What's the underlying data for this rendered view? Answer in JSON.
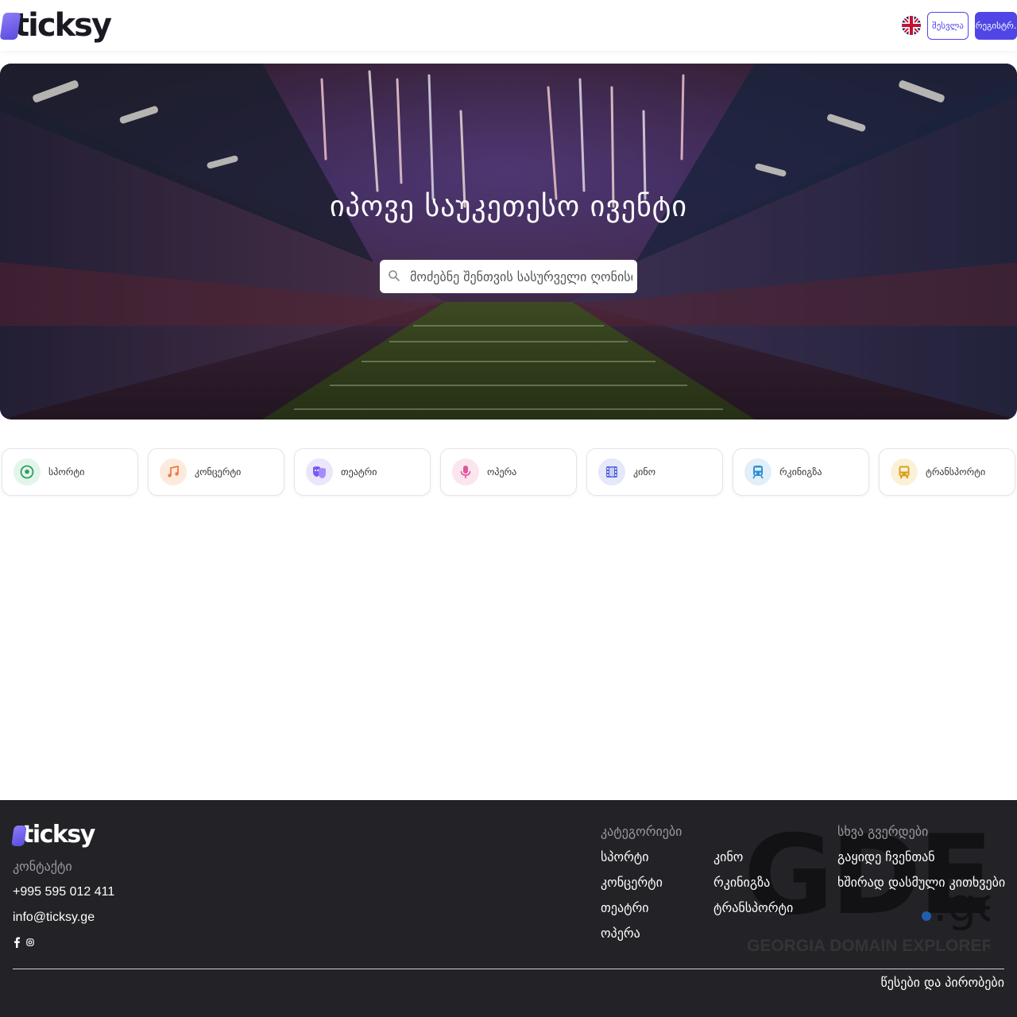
{
  "brand": {
    "name": "ticksy"
  },
  "header": {
    "login_label": "შესვლა",
    "register_label": "რეგისტრ."
  },
  "hero": {
    "title": "იპოვე საუკეთესო ივენტი",
    "search_placeholder": "მოძებნე შენთვის სასურველი ღონისძიება"
  },
  "categories": [
    {
      "label": "სპორტი",
      "icon": "soccer-ball-icon",
      "color": "#2f9e63",
      "bg": "#e3f5ea"
    },
    {
      "label": "კონცერტი",
      "icon": "music-note-icon",
      "color": "#ef7b3c",
      "bg": "#fdeadf"
    },
    {
      "label": "თეატრი",
      "icon": "theater-masks-icon",
      "color": "#7a5af0",
      "bg": "#ece6fd"
    },
    {
      "label": "ოპერა",
      "icon": "microphone-icon",
      "color": "#e0569b",
      "bg": "#fbe5ef"
    },
    {
      "label": "კინო",
      "icon": "film-icon",
      "color": "#5564d9",
      "bg": "#e5e8fb"
    },
    {
      "label": "რკინიგზა",
      "icon": "train-icon",
      "color": "#2f8fd0",
      "bg": "#e0effa"
    },
    {
      "label": "ტრანსპორტი",
      "icon": "bus-icon",
      "color": "#d9a21f",
      "bg": "#fbf1d8"
    }
  ],
  "footer": {
    "contact_heading": "კონტაქტი",
    "phone": "+995 595 012 411",
    "email": "info@ticksy.ge",
    "categories_heading": "კატეგორიები",
    "category_links_col1": [
      "სპორტი",
      "კონცერტი",
      "თეატრი",
      "ოპერა"
    ],
    "category_links_col2": [
      "კინო",
      "რკინიგზა",
      "ტრანსპორტი"
    ],
    "other_heading": "სხვა გვერდები",
    "other_links": [
      "გაყიდე ჩვენთან",
      "ხშირად დასმული კითხვები"
    ],
    "terms": "წესები და პირობები",
    "watermark_text": "GDE",
    "watermark_suffix": ".ge",
    "watermark_tagline": "GEORGIA DOMAIN EXPLORER"
  },
  "colors": {
    "accent": "#4f46e5",
    "footer_bg": "#232226"
  }
}
